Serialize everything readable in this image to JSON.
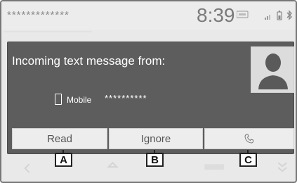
{
  "status_bar": {
    "contact_name": "*************",
    "clock": "8:39"
  },
  "dialog": {
    "title": "Incoming text message from:",
    "phone_type": "Mobile",
    "phone_number": "**********",
    "avatar_icon": "person-silhouette-icon"
  },
  "buttons": {
    "read": "Read",
    "ignore": "Ignore",
    "call_icon": "phone-handset-icon"
  },
  "callouts": {
    "a": "A",
    "b": "B",
    "c": "C"
  },
  "colors": {
    "dialog_bg": "#5d5d5d",
    "button_bg": "#ededed",
    "screen_bg": "#e9e9e9"
  }
}
